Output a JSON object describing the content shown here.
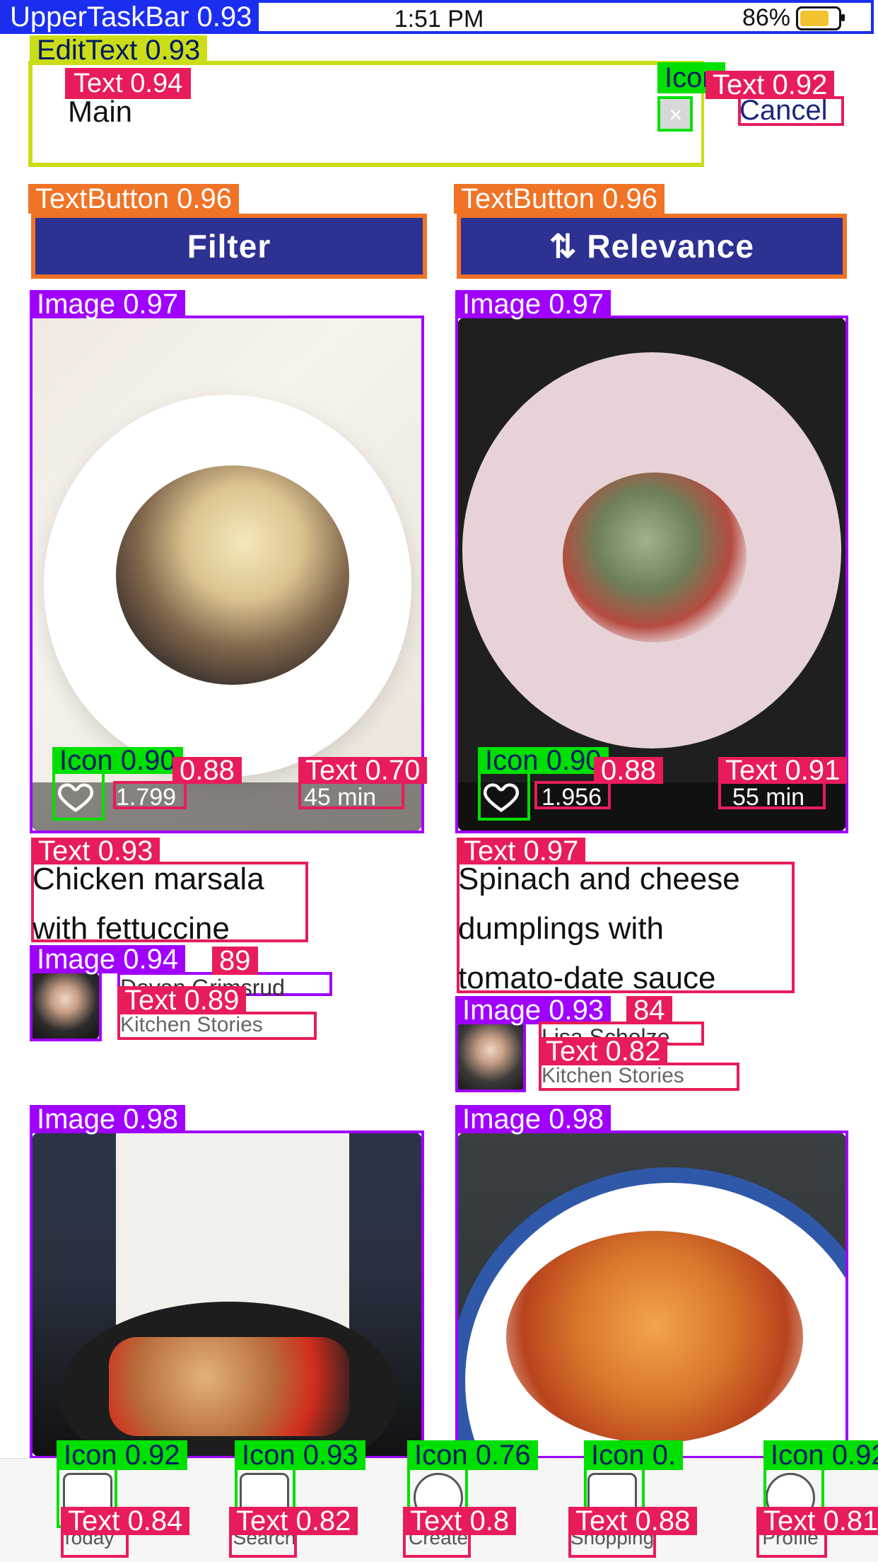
{
  "status_bar": {
    "time": "1:51 PM",
    "battery": "86%"
  },
  "search": {
    "label": "Text 0.94",
    "value": "Main",
    "cancel": "Cancel"
  },
  "toolbar": {
    "filter_label": "Filter",
    "relevance_label": "⇅ Relevance"
  },
  "annotations": {
    "top_bar": "UpperTaskBar 0.93",
    "search_edittext": "EditText 0.93",
    "text_main": "Text 0.94",
    "text_cancel": "Text 0.92",
    "icon_clear": "Icon",
    "filter_btn": "TextButton 0.96",
    "relevance_btn": "TextButton 0.96",
    "card1_img": "Image 0.97",
    "card2_img": "Image 0.97",
    "card1_icon": "Icon 0.90",
    "card1_text88": "0.88",
    "card1_time": "Text 0.70",
    "card2_icon": "Icon 0.90",
    "card2_text88": "0.88",
    "card2_time": "Text 0.91",
    "card1_title": "Text 0.93",
    "card2_title": "Text 0.97",
    "card1_avatar": "Image 0.94",
    "card1_avatar_score": "89",
    "card1_kitchen": "Text 0.89",
    "card2_avatar": "Image 0.93",
    "card2_avatar_score": "84",
    "card2_kitchen": "Text 0.82",
    "card3_img": "Image 0.98",
    "card4_img": "Image 0.98",
    "nav_icon1": "Icon 0.92",
    "nav_icon2": "Icon 0.93",
    "nav_icon3": "Icon 0.76",
    "nav_icon4": "Icon 0.",
    "nav_icon5": "Icon 0.92",
    "nav_text1": "Text 0.84",
    "nav_text2": "Text 0.82",
    "nav_text3": "Text 0.8",
    "nav_text4": "Text 0.88",
    "nav_text5": "Text 0.81"
  },
  "cards": [
    {
      "likes": "1.799",
      "time": "45 min",
      "title_lines": [
        "Chicken marsala",
        "with fettuccine"
      ],
      "author": "Devan Grimsrud",
      "source": "Kitchen Stories"
    },
    {
      "likes": "1.956",
      "time": "55 min",
      "title_lines": [
        "Spinach and cheese",
        "dumplings with",
        "tomato-date sauce"
      ],
      "author": "Lisa Scholze",
      "source": "Kitchen Stories"
    }
  ],
  "nav": [
    {
      "label": "Today"
    },
    {
      "label": "Search"
    },
    {
      "label": "Create"
    },
    {
      "label": "Shopping"
    },
    {
      "label": "Profile"
    }
  ],
  "colors": {
    "primary": "#2d3192",
    "annotation_text": "#e81c5a",
    "annotation_image": "#a000ff",
    "annotation_icon": "#00e000",
    "annotation_textbutton": "#f07326",
    "annotation_edittext": "#cbdd16",
    "annotation_topbar": "#1b2ef0"
  }
}
